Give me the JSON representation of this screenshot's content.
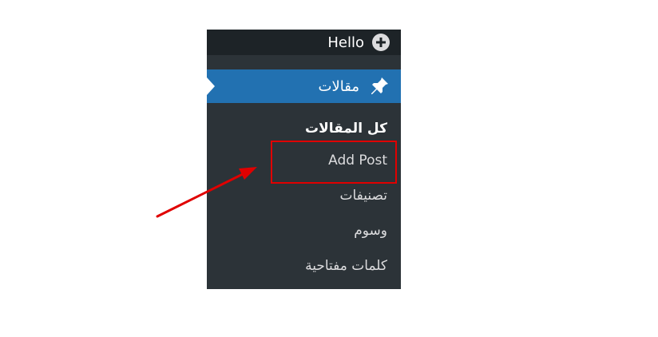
{
  "menu": {
    "top_item": {
      "label": "Hello",
      "icon": "plus-circle-icon"
    },
    "active_item": {
      "label": "مقالات",
      "icon": "pin-icon"
    },
    "submenu": [
      {
        "label": "كل المقالات",
        "current": true
      },
      {
        "label": "Add Post",
        "highlighted": true
      },
      {
        "label": "تصنيفات"
      },
      {
        "label": "وسوم"
      },
      {
        "label": "كلمات مفتاحية"
      }
    ]
  },
  "colors": {
    "menu_background": "#2c3338",
    "top_background": "#1d2327",
    "active_background": "#2271b1",
    "highlight": "#e00000"
  }
}
